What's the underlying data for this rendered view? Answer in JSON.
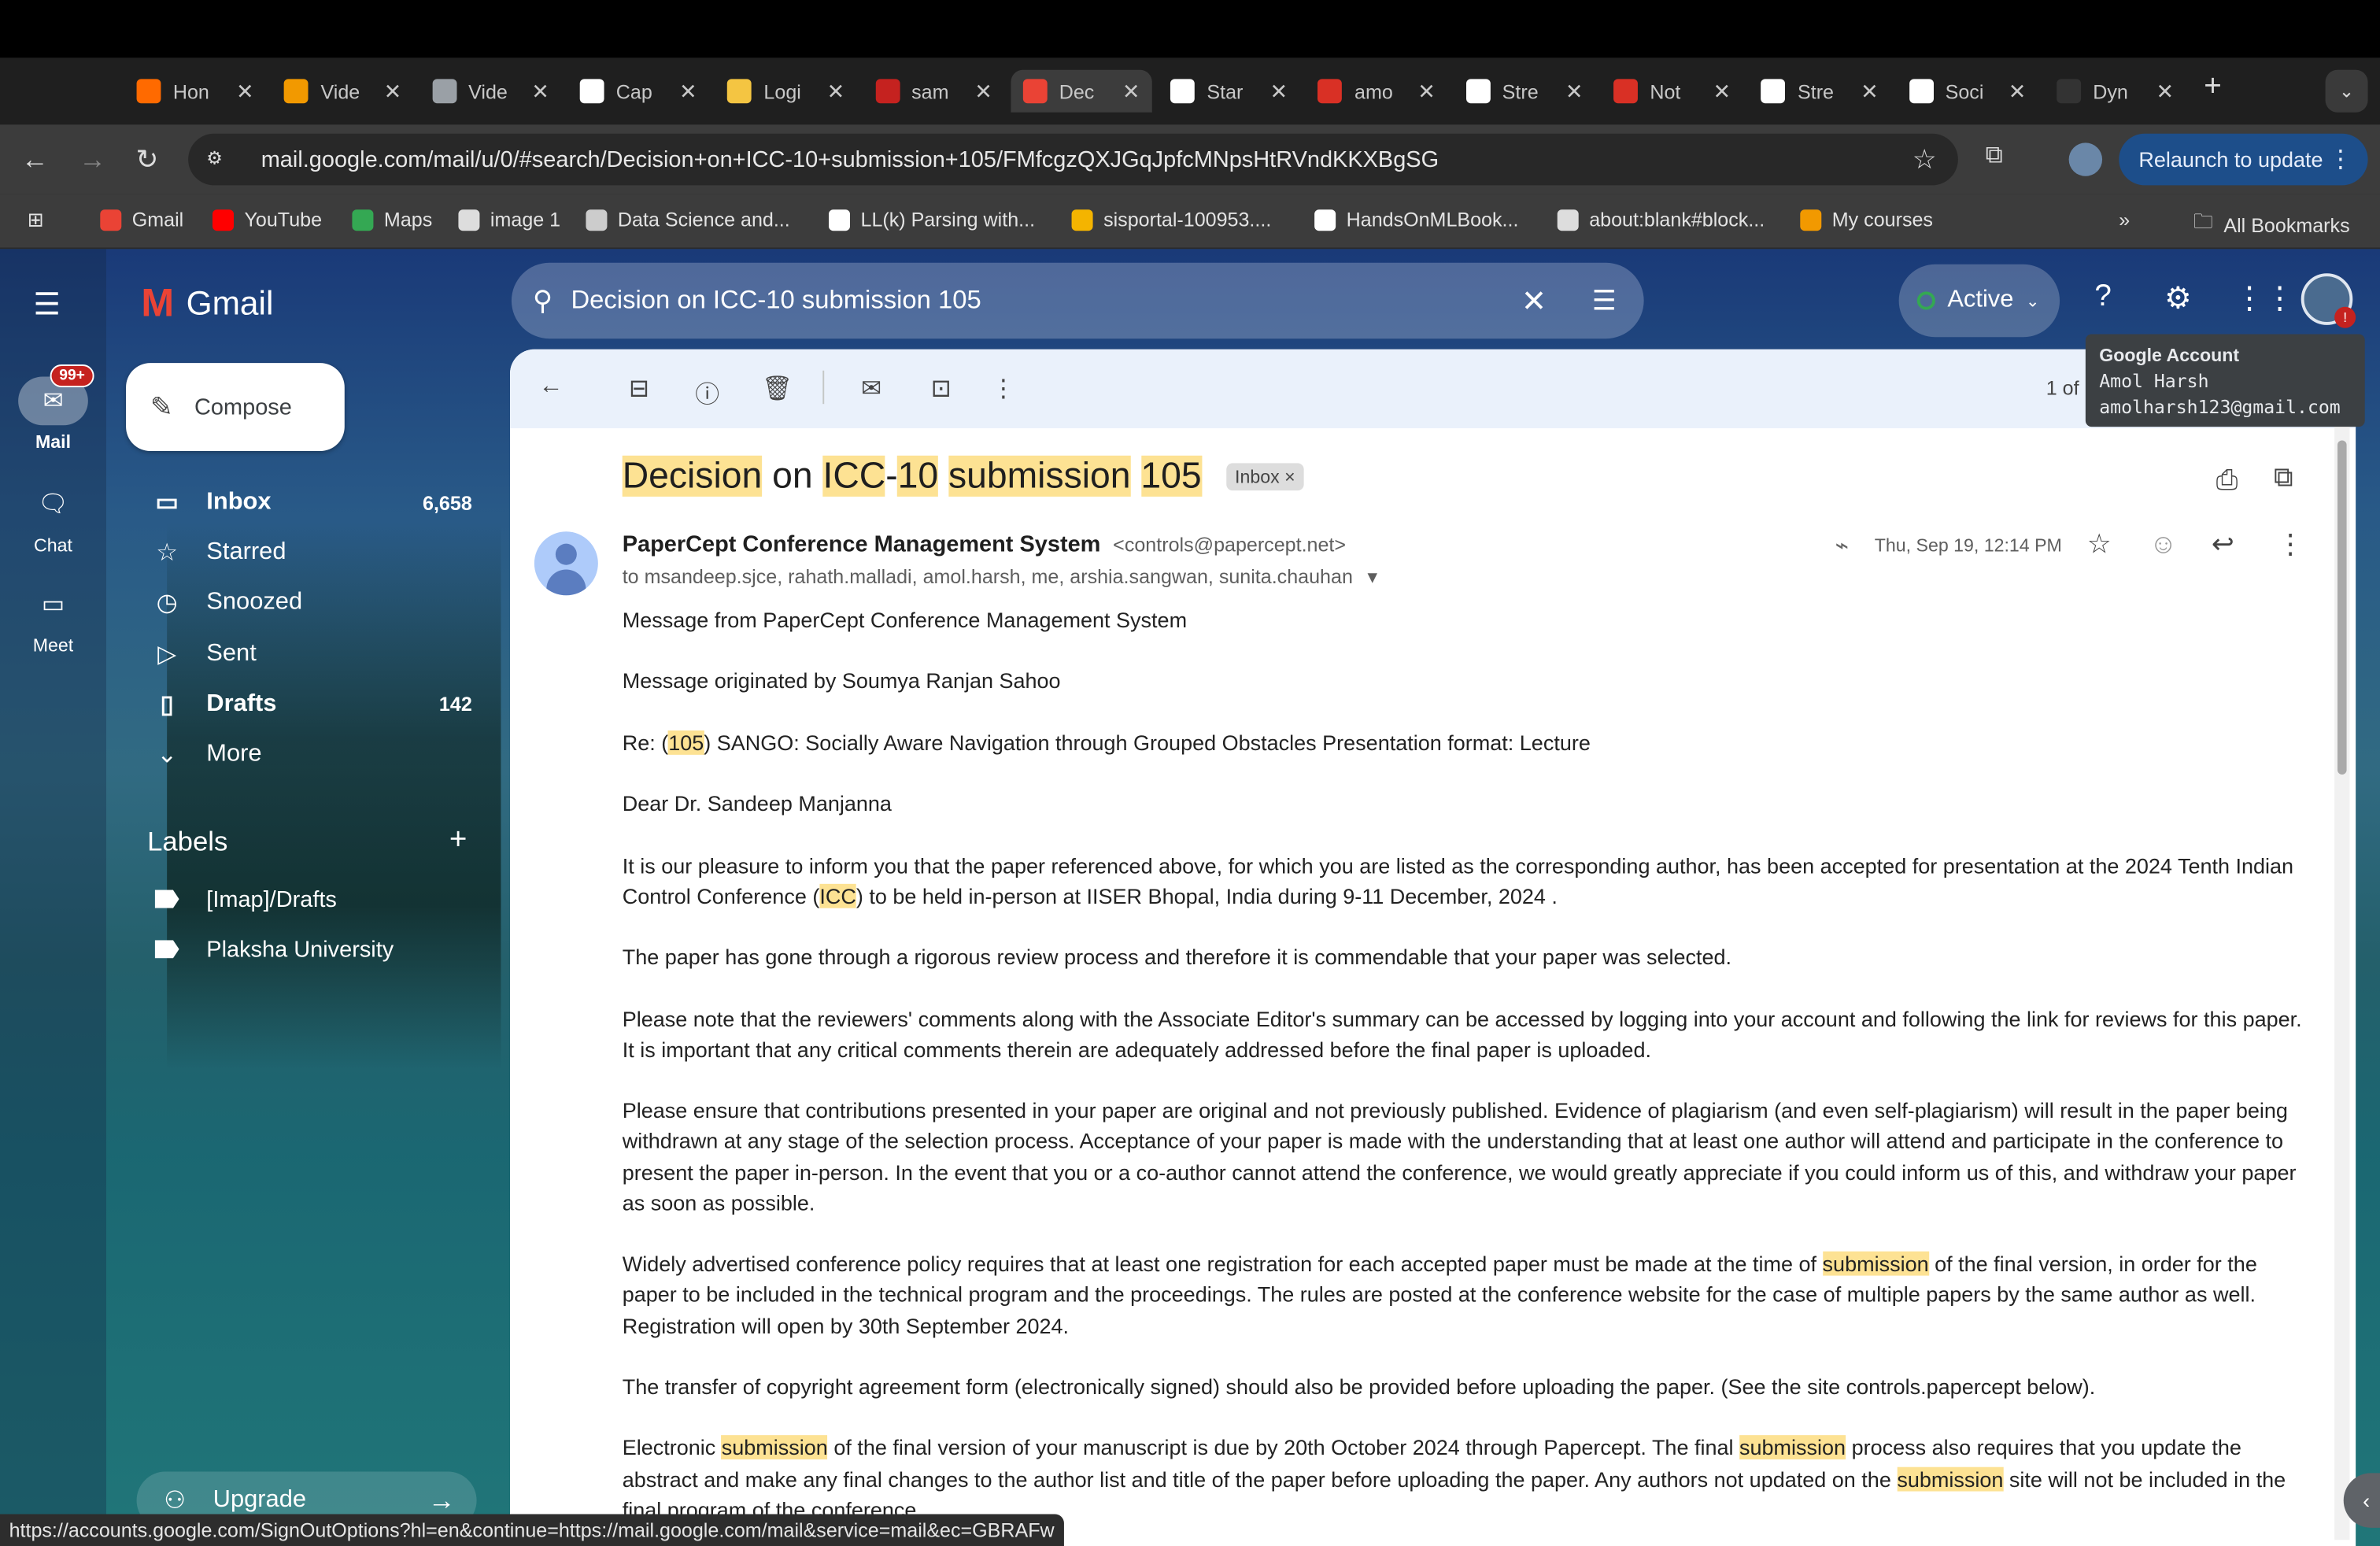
{
  "browser": {
    "tabs": [
      {
        "label": "Hon",
        "favicon_color": "#ff6a00"
      },
      {
        "label": "Vide",
        "favicon_color": "#f29900"
      },
      {
        "label": "Vide",
        "favicon_color": "#9aa0a6"
      },
      {
        "label": "Cap",
        "favicon_color": "#ffffff"
      },
      {
        "label": "Logi",
        "favicon_color": "#f4c542"
      },
      {
        "label": "sam",
        "favicon_color": "#c5221f"
      },
      {
        "label": "Dec",
        "favicon_color": "#ea4335"
      },
      {
        "label": "Star",
        "favicon_color": "#ffffff"
      },
      {
        "label": "amo",
        "favicon_color": "#d93025"
      },
      {
        "label": "Stre",
        "favicon_color": "#ffffff"
      },
      {
        "label": "Not",
        "favicon_color": "#d93025"
      },
      {
        "label": "Stre",
        "favicon_color": "#ffffff"
      },
      {
        "label": "Soci",
        "favicon_color": "#ffffff"
      },
      {
        "label": "Dyn",
        "favicon_color": "#333333"
      }
    ],
    "active_tab_index": 6,
    "new_tab": "+",
    "url": "mail.google.com/mail/u/0/#search/Decision+on+ICC-10+submission+105/FMfcgzQXJGqJpfcMNpsHtRVndKKXBgSG",
    "relaunch_label": "Relaunch to update",
    "bookmarks": [
      {
        "label": "Gmail",
        "color": "#ea4335"
      },
      {
        "label": "YouTube",
        "color": "#ff0000"
      },
      {
        "label": "Maps",
        "color": "#34a853"
      },
      {
        "label": "image 1",
        "color": "#dddddd"
      },
      {
        "label": "Data Science and...",
        "color": "#cccccc"
      },
      {
        "label": "LL(k) Parsing with...",
        "color": "#ffffff"
      },
      {
        "label": "sisportal-100953....",
        "color": "#f4b400"
      },
      {
        "label": "HandsOnMLBook...",
        "color": "#ffffff"
      },
      {
        "label": "about:blank#block...",
        "color": "#dddddd"
      },
      {
        "label": "My courses",
        "color": "#f29900"
      }
    ],
    "bookmarks_overflow": "»",
    "all_bookmarks": "All Bookmarks",
    "status_url": "https://accounts.google.com/SignOutOptions?hl=en&continue=https://mail.google.com/mail&service=mail&ec=GBRAFw"
  },
  "gmail": {
    "brand": "Gmail",
    "rail": {
      "mail": "Mail",
      "mail_badge": "99+",
      "chat": "Chat",
      "meet": "Meet"
    },
    "search_query": "Decision on ICC-10 submission 105",
    "status_chip": "Active",
    "account_tooltip": {
      "title": "Google Account",
      "name": "Amol Harsh",
      "email": "amolharsh123@gmail.com"
    },
    "compose_label": "Compose",
    "nav": [
      {
        "label": "Inbox",
        "count": "6,658",
        "icon": "inbox-icon",
        "bold": true
      },
      {
        "label": "Starred",
        "count": "",
        "icon": "star-icon",
        "bold": false
      },
      {
        "label": "Snoozed",
        "count": "",
        "icon": "clock-icon",
        "bold": false
      },
      {
        "label": "Sent",
        "count": "",
        "icon": "send-icon",
        "bold": false
      },
      {
        "label": "Drafts",
        "count": "142",
        "icon": "draft-icon",
        "bold": true
      },
      {
        "label": "More",
        "count": "",
        "icon": "chevron-down-icon",
        "bold": false
      }
    ],
    "labels_heading": "Labels",
    "labels_add": "+",
    "labels": [
      "[Imap]/Drafts",
      "Plaksha University"
    ],
    "upgrade_label": "Upgrade"
  },
  "email": {
    "pager": "1 of 1",
    "subject_parts": [
      {
        "text": "Decision",
        "hl": true
      },
      {
        "text": "on",
        "hl": false
      },
      {
        "text": "ICC",
        "hl": true
      },
      {
        "text": "-",
        "hl": false
      },
      {
        "text": "10",
        "hl": true
      },
      {
        "text": "submission",
        "hl": true
      },
      {
        "text": "105",
        "hl": true
      }
    ],
    "inbox_chip": "Inbox ×",
    "sender_name": "PaperCept Conference Management System",
    "sender_email": "<controls@papercept.net>",
    "to_line": "to msandeep.sjce, rahath.malladi, amol.harsh, me, arshia.sangwan, sunita.chauhan",
    "datetime": "Thu, Sep 19, 12:14 PM",
    "paragraphs": [
      [
        {
          "t": "Message from PaperCept Conference Management System"
        }
      ],
      [
        {
          "t": "Message originated by Soumya Ranjan Sahoo"
        }
      ],
      [
        {
          "t": "Re: ("
        },
        {
          "t": "105",
          "h": 1
        },
        {
          "t": ") SANGO: Socially Aware Navigation through Grouped Obstacles Presentation format: Lecture"
        }
      ],
      [
        {
          "t": "Dear Dr. Sandeep Manjanna"
        }
      ],
      [
        {
          "t": "It is our pleasure to inform you that the paper referenced above, for which you are listed as the corresponding author, has been accepted for presentation at the 2024 Tenth Indian Control Conference ("
        },
        {
          "t": "ICC",
          "h": 1
        },
        {
          "t": ") to be held in-person at IISER Bhopal, India during 9-11 December, 2024 ."
        }
      ],
      [
        {
          "t": "The paper has gone through a rigorous review process and therefore it is commendable that your paper was selected."
        }
      ],
      [
        {
          "t": "Please note that the reviewers' comments along with the Associate Editor's summary can be accessed by logging into your account and following the link for reviews for this paper. It is important that any critical comments therein are adequately addressed before the final paper is uploaded."
        }
      ],
      [
        {
          "t": "Please ensure that contributions presented in your paper are original and not previously published. Evidence of plagiarism (and even self-plagiarism) will result in the paper being withdrawn at any stage of the selection process. Acceptance of your paper is made with the understanding that at least one author will attend and participate in the conference to present the paper in-person. In the event that you or a co-author cannot attend the conference, we would greatly appreciate if you could inform us of this, and withdraw your paper as soon as possible."
        }
      ],
      [
        {
          "t": "Widely advertised conference policy requires that at least one registration for each accepted paper must be made at the time of "
        },
        {
          "t": "submission",
          "h": 1
        },
        {
          "t": " of the final version, in order for the paper to be included in the technical program and the proceedings. The rules are posted at the conference website for the case of multiple papers by the same author as well. Registration will open by 30th September 2024."
        }
      ],
      [
        {
          "t": "The transfer of copyright agreement form (electronically signed) should also be provided before uploading the paper. (See the site controls.papercept below)."
        }
      ],
      [
        {
          "t": "Electronic "
        },
        {
          "t": "submission",
          "h": 1
        },
        {
          "t": " of the final version of your manuscript is due by 20th October 2024 through Papercept. The final "
        },
        {
          "t": "submission",
          "h": 1
        },
        {
          "t": " process also requires that you update the abstract and make any final changes to the author list and title of the paper before uploading the paper. Any authors not updated on the "
        },
        {
          "t": "submission",
          "h": 1
        },
        {
          "t": " site will not be included in the final program of the conference."
        }
      ]
    ]
  }
}
